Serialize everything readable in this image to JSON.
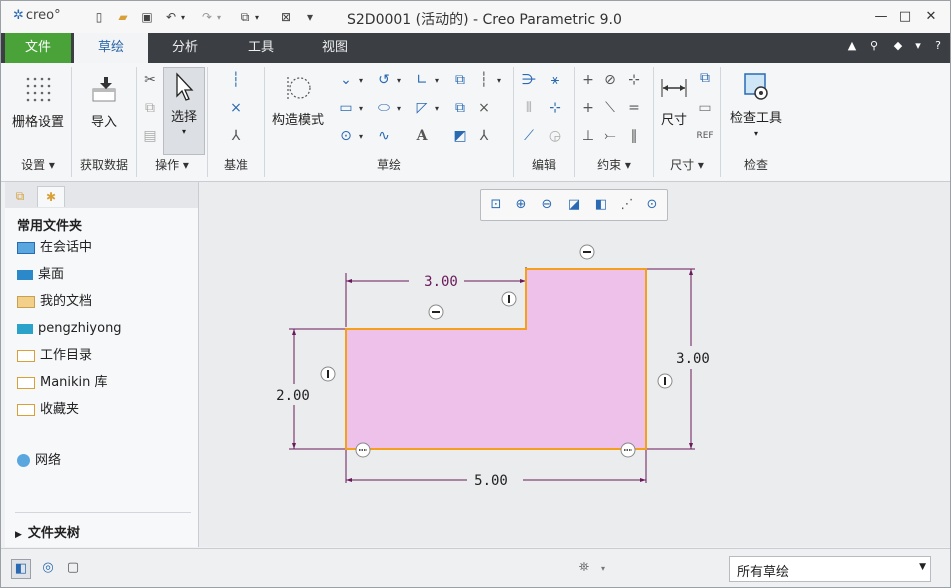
{
  "app": {
    "logo": "creo°",
    "title": "S2D0001 (活动的) - Creo Parametric 9.0"
  },
  "tabs": {
    "file": "文件",
    "sketch": "草绘",
    "analysis": "分析",
    "tools": "工具",
    "view": "视图"
  },
  "ribbon": {
    "grid_settings": "栅格设置",
    "settings_group": "设置",
    "import": "导入",
    "get_data_group": "获取数据",
    "select": "选择",
    "operations_group": "操作",
    "datum_group": "基准",
    "construction_mode": "构造模式",
    "sketch_group": "草绘",
    "edit_group": "编辑",
    "constraints_group": "约束",
    "dimension": "尺寸",
    "dimension_group": "尺寸",
    "inspect_tool": "检查工具",
    "inspect_group": "检查"
  },
  "left_panel": {
    "heading": "常用文件夹",
    "items": [
      "在会话中",
      "桌面",
      "我的文档",
      "pengzhiyong",
      "工作目录",
      "Manikin 库",
      "收藏夹"
    ],
    "network": "网络",
    "folder_tree": "文件夹树"
  },
  "sketch": {
    "dims": {
      "top_width": "3.00",
      "left_height": "2.00",
      "right_height": "3.00",
      "bottom_width": "5.00"
    },
    "fill_color": "#edc1ea",
    "edge_color": "#f5a01c",
    "dim_color": "#6a1a5a"
  },
  "status": {
    "filter_value": "所有草绘"
  },
  "colors": {
    "accent": "#2a65a6",
    "file_tab": "#49a339",
    "tab_bar": "#3b3f44"
  }
}
